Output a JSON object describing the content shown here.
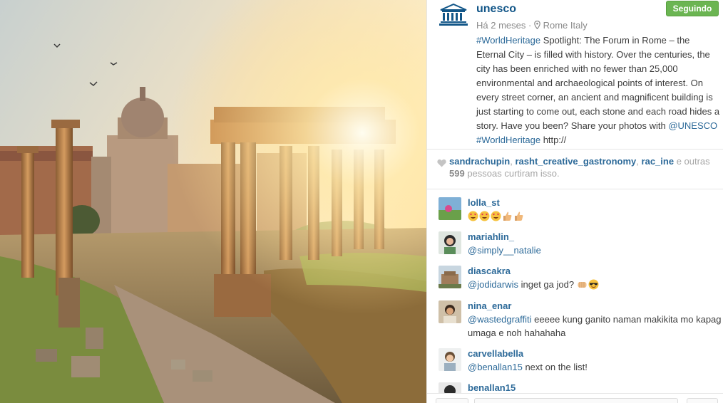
{
  "post": {
    "username": "unesco",
    "follow_label": "Seguindo",
    "time_ago": "Há 2 meses",
    "separator": "·",
    "location": "Rome Italy",
    "caption": {
      "hashtag1": "#WorldHeritage",
      "text1": " Spotlight: The Forum in Rome – the Eternal City – is filled with history. Over the centuries, the city has been enriched with no fewer than 25,000 environmental and archaeological points of interest. On every street corner, an ancient and magnificent building is just starting to come out, each stone and each road hides a story. Have you been? Share your photos with ",
      "mention1": "@UNESCO",
      "space": " ",
      "hashtag2": "#WorldHeritage",
      "text2": " http://"
    }
  },
  "likes": {
    "user1": "sandrachupin",
    "sep1": ", ",
    "user2": "rasht_creative_gastronomy",
    "sep2": ", ",
    "user3": "rac_ine",
    "text_and": " e outras ",
    "count": "599",
    "text_rest": " pessoas curtiram isso."
  },
  "comments": [
    {
      "user": "lolla_st",
      "mention": "",
      "text": "",
      "emoji": [
        "heart-eyes-emoji",
        "heart-eyes-emoji",
        "heart-eyes-emoji",
        "thumbs-up-emoji",
        "thumbs-up-emoji"
      ]
    },
    {
      "user": "mariahlin_",
      "mention": "@simply__natalie",
      "text": "",
      "emoji": []
    },
    {
      "user": "diascakra",
      "mention": "@jodidarwis",
      "text": " inget ga jod? ",
      "emoji": [
        "fist-emoji",
        "sunglasses-emoji"
      ]
    },
    {
      "user": "nina_enar",
      "mention": "@wastedgraffiti",
      "text": " eeeee kung ganito naman makikita mo kapag umaga e noh hahahaha",
      "emoji": []
    },
    {
      "user": "carvellabella",
      "mention": "@benallan15",
      "text": " next on the list!",
      "emoji": []
    },
    {
      "user": "benallan15",
      "mention": "",
      "text": "",
      "emoji": []
    }
  ],
  "icons": {
    "logo": "unesco-logo",
    "location": "location-pin-icon",
    "like": "heart-icon"
  },
  "colors": {
    "link": "#2d6a99",
    "username": "#125688",
    "follow_button": "#6bb552",
    "muted": "#8a8a8a"
  }
}
